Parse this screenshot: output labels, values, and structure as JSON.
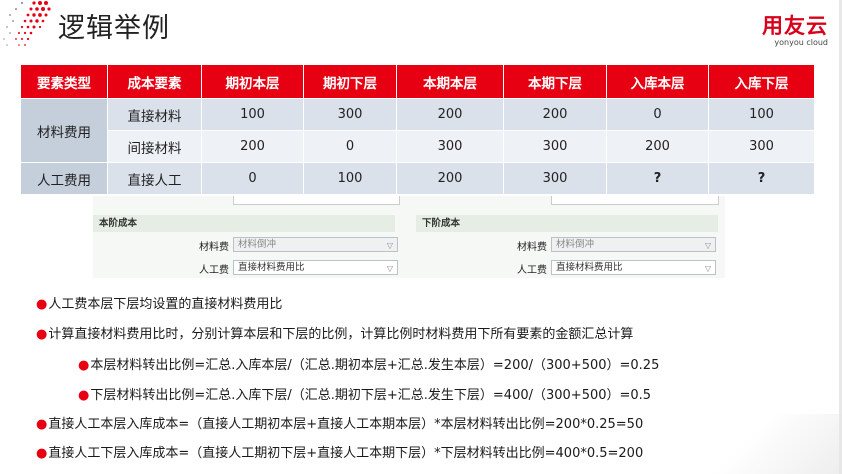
{
  "slide": {
    "title": "逻辑举例"
  },
  "logo": {
    "main": "用友云",
    "sub": "yonyou cloud"
  },
  "table": {
    "headers": [
      "要素类型",
      "成本要素",
      "期初本层",
      "期初下层",
      "本期本层",
      "本期下层",
      "入库本层",
      "入库下层"
    ],
    "categories": [
      "材料费用",
      "人工费用"
    ],
    "rows": [
      {
        "element": "直接材料",
        "values": [
          "100",
          "300",
          "200",
          "200",
          "0",
          "100"
        ]
      },
      {
        "element": "间接材料",
        "values": [
          "200",
          "0",
          "300",
          "300",
          "200",
          "300"
        ]
      },
      {
        "element": "直接人工",
        "values": [
          "0",
          "100",
          "200",
          "300",
          "?",
          "?"
        ]
      }
    ]
  },
  "form": {
    "left_section": "本阶成本",
    "right_section": "下阶成本",
    "material_label": "材料费",
    "labor_label": "人工费",
    "left_material_value": "材料倒冲",
    "left_labor_value": "直接材料费用比",
    "right_material_value": "材料倒冲",
    "right_labor_value": "直接材料费用比"
  },
  "bullets": [
    "人工费本层下层均设置的直接材料费用比",
    "计算直接材料费用比时，分别计算本层和下层的比例，计算比例时材料费用下所有要素的金额汇总计算",
    "本层材料转出比例=汇总.入库本层/（汇总.期初本层+汇总.发生本层）=200/（300+500）=0.25",
    "下层材料转出比例=汇总.入库下层/（汇总.期初下层+汇总.发生下层）=400/（300+500）=0.5",
    "直接人工本层入库成本=（直接人工期初本层+直接人工本期本层）*本层材料转出比例=200*0.25=50",
    "直接人工下层入库成本=（直接人工期初下层+直接人工本期下层）*下层材料转出比例=400*0.5=200"
  ]
}
